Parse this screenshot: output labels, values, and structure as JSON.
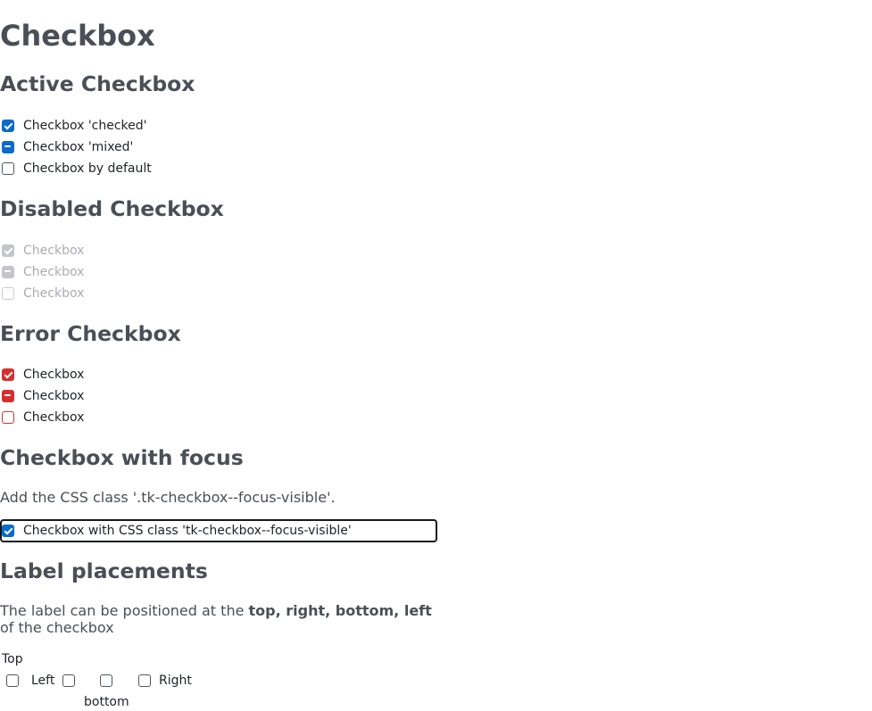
{
  "page": {
    "title": "Checkbox"
  },
  "active": {
    "heading": "Active Checkbox",
    "items": [
      {
        "label": "Checkbox 'checked'",
        "state": "checked"
      },
      {
        "label": "Checkbox 'mixed'",
        "state": "mixed"
      },
      {
        "label": "Checkbox by default",
        "state": "unchecked"
      }
    ]
  },
  "disabled": {
    "heading": "Disabled Checkbox",
    "items": [
      {
        "label": "Checkbox",
        "state": "checked"
      },
      {
        "label": "Checkbox",
        "state": "mixed"
      },
      {
        "label": "Checkbox",
        "state": "unchecked"
      }
    ]
  },
  "error": {
    "heading": "Error Checkbox",
    "items": [
      {
        "label": "Checkbox",
        "state": "checked"
      },
      {
        "label": "Checkbox",
        "state": "mixed"
      },
      {
        "label": "Checkbox",
        "state": "unchecked"
      }
    ]
  },
  "focus": {
    "heading": "Checkbox with focus",
    "description": "Add the CSS class '.tk-checkbox--focus-visible'.",
    "item": {
      "label": "Checkbox with CSS class 'tk-checkbox--focus-visible'",
      "state": "checked"
    }
  },
  "placements": {
    "heading": "Label placements",
    "description_prefix": "The label can be positioned at the ",
    "description_bold": "top, right, bottom, left",
    "description_suffix": "of the checkbox",
    "top_label": "Top",
    "left_label": "Left",
    "bottom_label": "bottom",
    "right_label": "Right"
  },
  "colors": {
    "accent": "#0b6bcb",
    "error": "#d62f2f",
    "disabled": "#c3c5c9",
    "heading": "#4a4f57"
  }
}
